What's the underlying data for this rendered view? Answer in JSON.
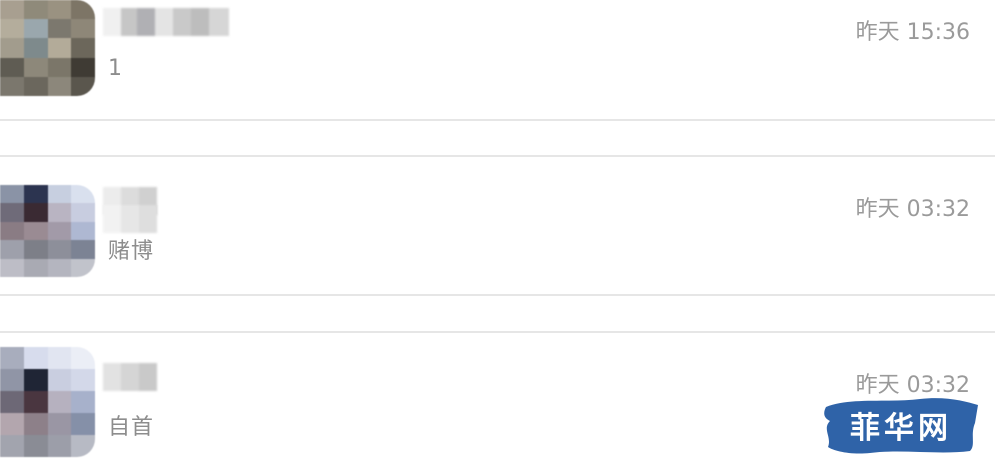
{
  "conversations": [
    {
      "message": "1",
      "time": "昨天 15:36"
    },
    {
      "message": "赌博",
      "time": "昨天 03:32"
    },
    {
      "message": "自首",
      "time": "昨天 03:32"
    }
  ],
  "watermark": {
    "text": "菲华网",
    "color": "#2f63a8"
  },
  "colors": {
    "divider": "#e6e6e6",
    "text_gray": "#8d8d8d",
    "time_gray": "#9a9a9a"
  }
}
